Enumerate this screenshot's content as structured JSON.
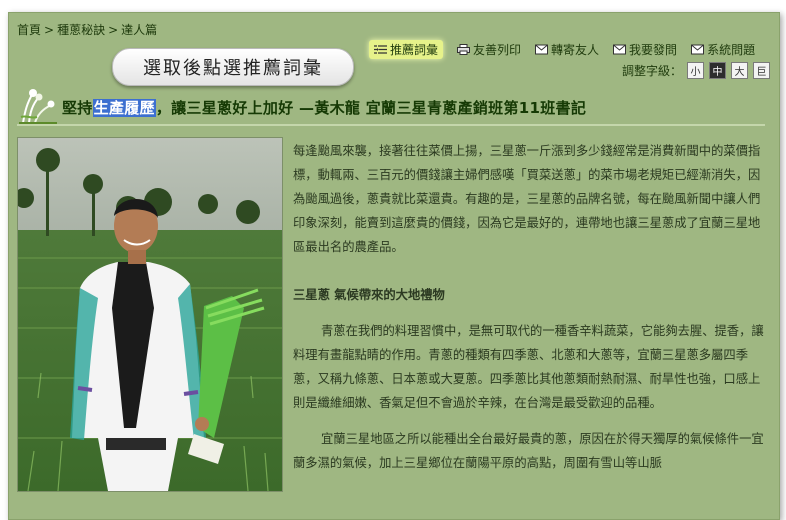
{
  "breadcrumb": {
    "home": "首頁",
    "level2": "種蔥秘訣",
    "level3": "達人篇",
    "separator": ">"
  },
  "select_button_label": "選取後點選推薦詞彙",
  "toolbar": {
    "recommend": "推薦詞彙",
    "print": "友善列印",
    "forward": "轉寄友人",
    "ask": "我要發問",
    "system": "系統問題"
  },
  "font_size": {
    "label": "調整字級：",
    "small": "小",
    "medium": "中",
    "large": "大",
    "xlarge": "巨"
  },
  "article": {
    "title_prefix": "堅持",
    "title_highlight": "生產履歷",
    "title_suffix": "，讓三星蔥好上加好 —黃木龍 宜蘭三星青蔥產銷班第11班書記",
    "para1": "每逢颱風來襲，接著往往菜價上揚，三星蔥一斤漲到多少錢經常是消費新聞中的菜價指標，動輒兩、三百元的價錢讓主婦們感嘆「買菜送蔥」的菜市場老規矩已經漸消失，因為颱風過後，蔥貴就比菜還貴。有趣的是，三星蔥的品牌名號，每在颱風新聞中讓人們印象深刻，能賣到這麼貴的價錢，因為它是最好的，連帶地也讓三星蔥成了宜蘭三星地區最出名的農產品。",
    "subtitle": "三星蔥 氣候帶來的大地禮物",
    "para2": "青蔥在我們的料理習慣中，是無可取代的一種香辛料蔬菜，它能夠去腥、提香，讓料理有畫龍點睛的作用。青蔥的種類有四季蔥、北蔥和大蔥等，宜蘭三星蔥多屬四季蔥，又稱九條蔥、日本蔥或大夏蔥。四季蔥比其他蔥類耐熱耐濕、耐旱性也強，口感上則是纖維細嫩、香氣足但不會過於辛辣，在台灣是最受歡迎的品種。",
    "para3": "宜蘭三星地區之所以能種出全台最好最貴的蔥，原因在於得天獨厚的氣候條件一宜蘭多濕的氣候，加上三星鄉位在蘭陽平原的高點，周圍有雪山等山脈"
  },
  "colors": {
    "panel": "#9fb782",
    "title_text": "#163a05",
    "highlight": "#3c6fd0",
    "active_tool": "#e6f28a"
  }
}
